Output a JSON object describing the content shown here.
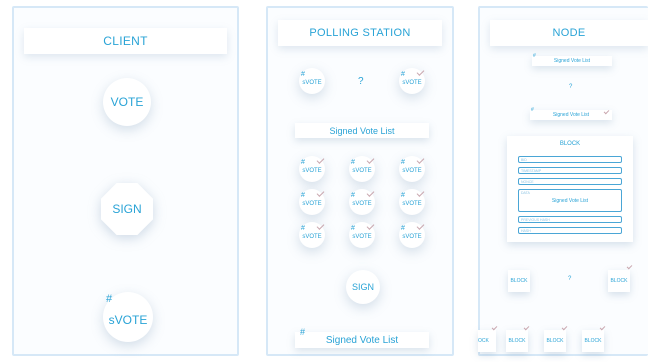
{
  "client": {
    "title": "CLIENT",
    "vote": "VOTE",
    "sign": "SIGN",
    "hash": "#",
    "svote": "sVOTE"
  },
  "polling": {
    "title": "POLLING STATION",
    "svote": "sVOTE",
    "hash": "#",
    "question": "?",
    "signed_list": "Signed Vote List",
    "sign": "SIGN",
    "bottom_list": "Signed Vote List"
  },
  "node": {
    "title": "NODE",
    "hash": "#",
    "signed_list_top": "Signed Vote List",
    "question": "?",
    "signed_list_mid": "Signed Vote List",
    "block": {
      "title": "BLOCK",
      "fields": [
        "BID",
        "TIMESTAMP",
        "NONCE"
      ],
      "data_label": "DATA",
      "data_value": "Signed Vote List",
      "fields_after": [
        "PREVIOUS HASH",
        "HASH"
      ]
    },
    "chain_left": "BLOCK",
    "chain_q": "?",
    "chain_right": "BLOCK",
    "bottom_chain": [
      "OCK",
      "BLOCK",
      "BLOCK",
      "BLOCK"
    ]
  }
}
